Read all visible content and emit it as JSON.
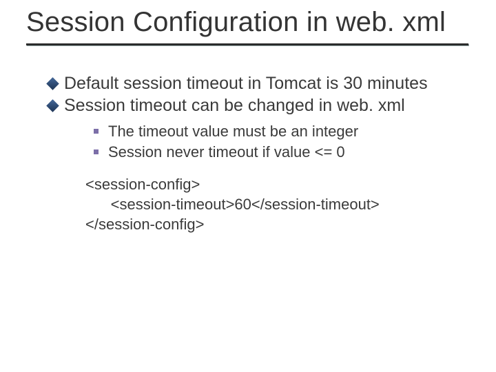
{
  "title": "Session Configuration in web. xml",
  "bullets": {
    "b1": "Default session timeout in Tomcat is 30 minutes",
    "b2": "Session timeout can be changed in web. xml"
  },
  "sub": {
    "s1": "The timeout value must be an integer",
    "s2": "Session never timeout if value <= 0"
  },
  "code": "<session-config>\n      <session-timeout>60</session-timeout>\n</session-config>"
}
